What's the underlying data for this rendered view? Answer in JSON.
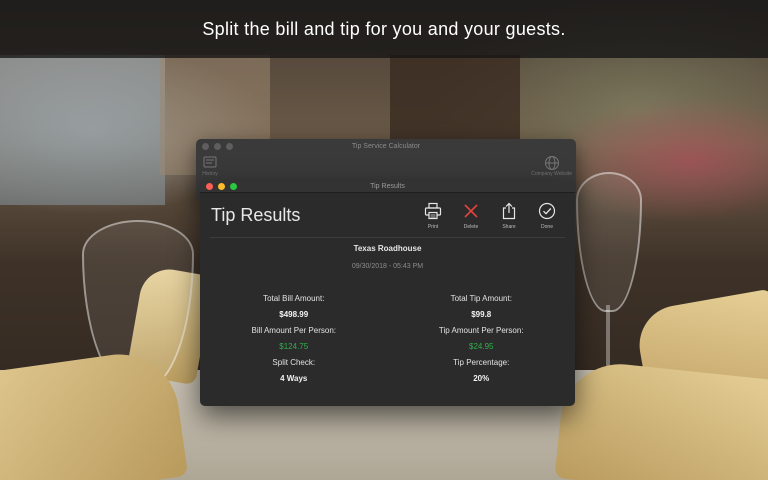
{
  "banner": {
    "text": "Split the bill and tip for you and your guests."
  },
  "back_window": {
    "title": "Tip Service Calculator",
    "left_tool": {
      "label": "History",
      "icon": "history-icon"
    },
    "right_tool": {
      "label": "Company Website",
      "icon": "globe-icon"
    }
  },
  "results_window": {
    "title": "Tip Results",
    "heading": "Tip Results",
    "actions": [
      {
        "label": "Print",
        "icon": "printer-icon"
      },
      {
        "label": "Delete",
        "icon": "close-icon",
        "color": "#e0443e"
      },
      {
        "label": "Share",
        "icon": "share-icon"
      },
      {
        "label": "Done",
        "icon": "checkmark-circle-icon"
      }
    ],
    "restaurant": "Texas Roadhouse",
    "datetime": "09/30/2018 - 05:43 PM",
    "left": [
      {
        "label": "Total Bill Amount:",
        "value": "$498.99"
      },
      {
        "label": "Bill Amount Per Person:",
        "value": "$124.75",
        "highlight": true
      },
      {
        "label": "Split Check:",
        "value": "4 Ways"
      }
    ],
    "right": [
      {
        "label": "Total Tip Amount:",
        "value": "$99.8"
      },
      {
        "label": "Tip Amount Per Person:",
        "value": "$24.95",
        "highlight": true
      },
      {
        "label": "Tip Percentage:",
        "value": "20%"
      }
    ]
  },
  "colors": {
    "accent_green": "#2fb14a",
    "delete_red": "#e0443e"
  }
}
